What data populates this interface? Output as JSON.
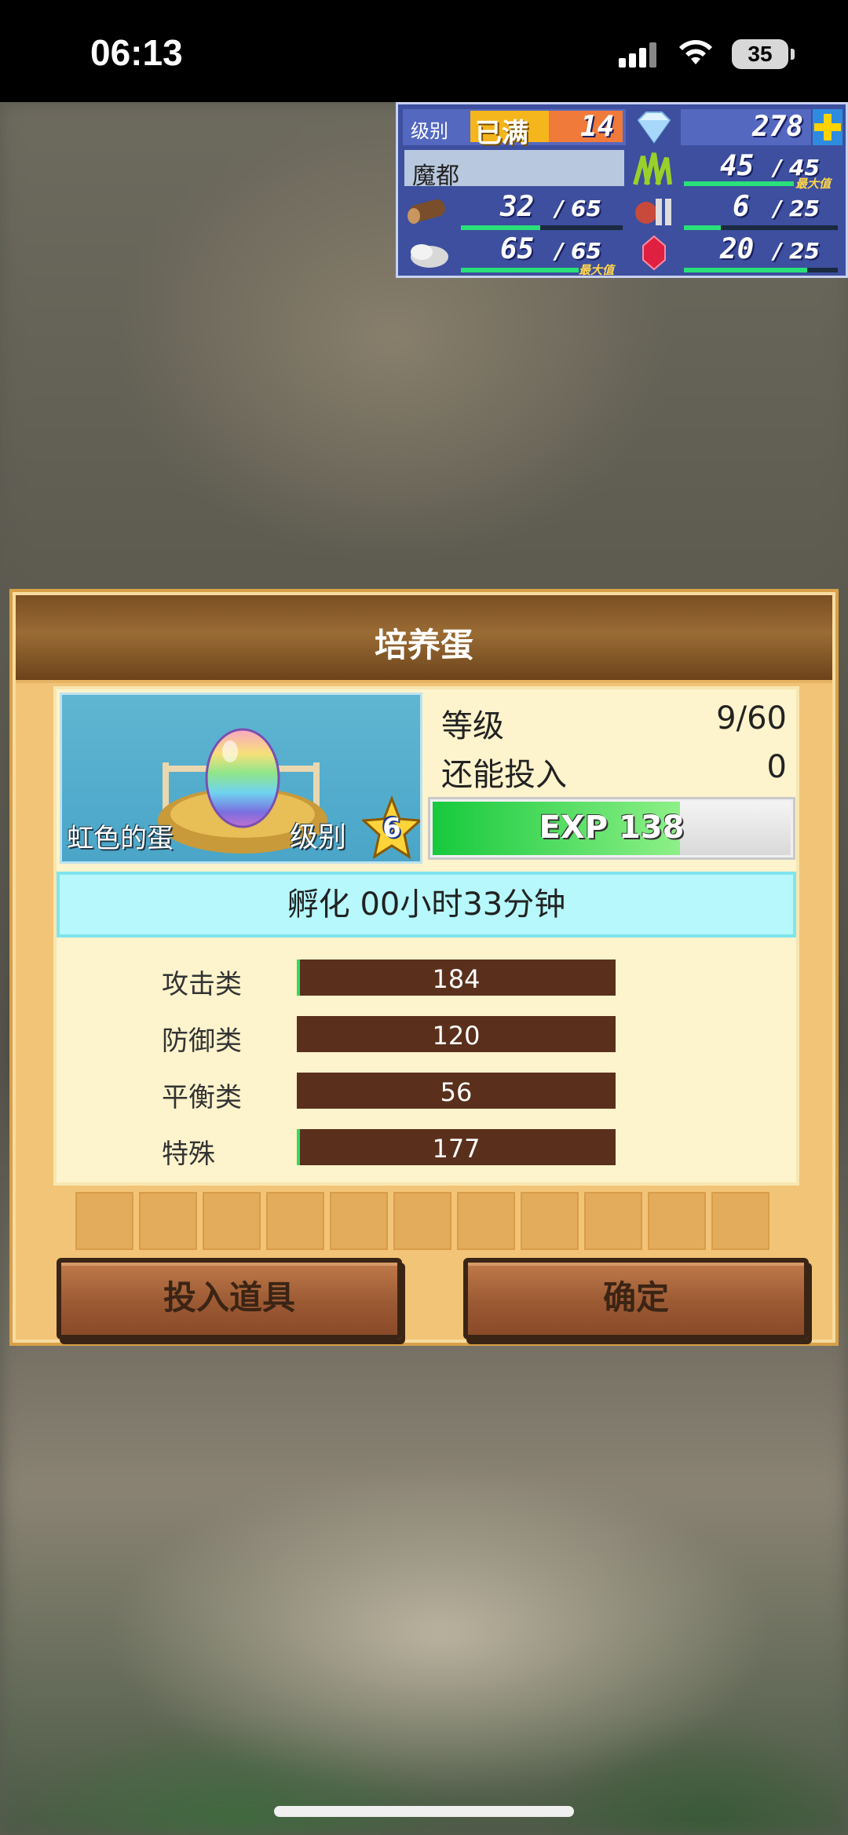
{
  "status_bar": {
    "time": "06:13",
    "battery": "35"
  },
  "hud": {
    "level_label": "级别",
    "level_state": "已满",
    "level": "14",
    "gems": "278",
    "location": "魔都",
    "grass": "45",
    "grass_max": "45",
    "grass_fill": 1.0,
    "grass_tag": "最大值",
    "wood": "32",
    "wood_max": "65",
    "wood_fill": 0.49,
    "food": "6",
    "food_max": "25",
    "food_fill": 0.24,
    "ore": "65",
    "ore_max": "65",
    "ore_fill": 1.0,
    "ore_tag": "最大值",
    "ruby": "20",
    "ruby_max": "25",
    "ruby_fill": 0.8
  },
  "modal": {
    "title": "培养蛋",
    "egg_name": "虹色的蛋",
    "egg_level_label": "级别",
    "egg_level": "6",
    "grade_label": "等级",
    "grade_value": "9/60",
    "remaining_label": "还能投入",
    "remaining_value": "0",
    "exp_text": "EXP 138",
    "exp_fill": 0.69,
    "hatch_text": "孵化 00小时33分钟",
    "traits": [
      {
        "label": "攻击类",
        "value": "184",
        "fill": 0.01
      },
      {
        "label": "防御类",
        "value": "120",
        "fill": 0
      },
      {
        "label": "平衡类",
        "value": "56",
        "fill": 0
      },
      {
        "label": "特殊",
        "value": "177",
        "fill": 0.01
      }
    ],
    "slot_count": 11,
    "add_item_button": "投入道具",
    "confirm_button": "确定"
  }
}
